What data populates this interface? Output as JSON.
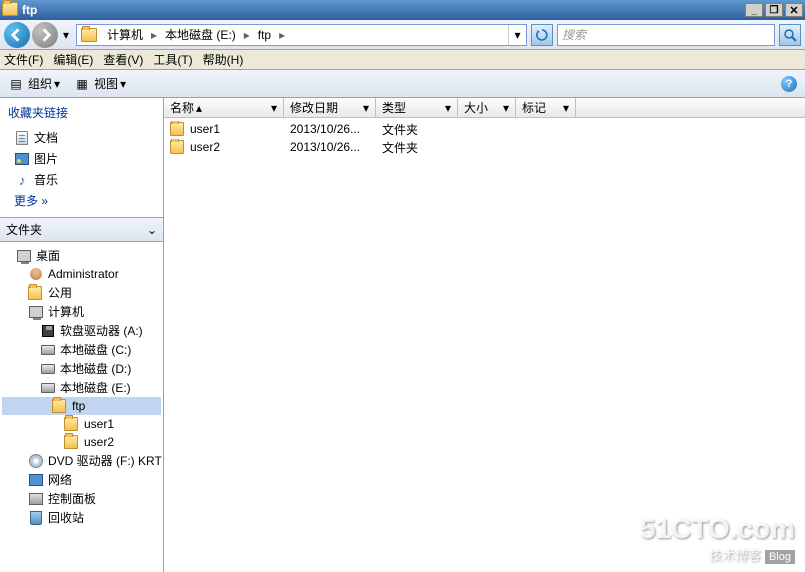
{
  "window": {
    "title": "ftp"
  },
  "nav": {
    "address_segments": [
      "计算机",
      "本地磁盘 (E:)",
      "ftp"
    ],
    "search_placeholder": "搜索"
  },
  "menu": {
    "file": "文件(F)",
    "edit": "编辑(E)",
    "view": "查看(V)",
    "tools": "工具(T)",
    "help": "帮助(H)"
  },
  "toolbar": {
    "organize": "组织",
    "views": "视图"
  },
  "favorites": {
    "header": "收藏夹链接",
    "items": [
      {
        "icon": "doc",
        "label": "文档"
      },
      {
        "icon": "pic",
        "label": "图片"
      },
      {
        "icon": "music",
        "label": "音乐"
      }
    ],
    "more": "更多  »"
  },
  "folders_header": "文件夹",
  "tree": [
    {
      "ind": 0,
      "icon": "desktop",
      "label": "桌面",
      "exp": ""
    },
    {
      "ind": 1,
      "icon": "user",
      "label": "Administrator",
      "exp": ""
    },
    {
      "ind": 1,
      "icon": "folder",
      "label": "公用",
      "exp": ""
    },
    {
      "ind": 1,
      "icon": "computer",
      "label": "计算机",
      "exp": ""
    },
    {
      "ind": 2,
      "icon": "floppy",
      "label": "软盘驱动器 (A:)",
      "exp": ""
    },
    {
      "ind": 2,
      "icon": "drive",
      "label": "本地磁盘 (C:)",
      "exp": ""
    },
    {
      "ind": 2,
      "icon": "drive",
      "label": "本地磁盘 (D:)",
      "exp": ""
    },
    {
      "ind": 2,
      "icon": "drive",
      "label": "本地磁盘 (E:)",
      "exp": ""
    },
    {
      "ind": 3,
      "icon": "folder",
      "label": "ftp",
      "exp": "",
      "sel": true
    },
    {
      "ind": 4,
      "icon": "folder",
      "label": "user1",
      "exp": ""
    },
    {
      "ind": 4,
      "icon": "folder",
      "label": "user2",
      "exp": ""
    },
    {
      "ind": 2,
      "icon": "cd",
      "label": "DVD 驱动器 (F:) KRT",
      "exp": ""
    },
    {
      "ind": 1,
      "icon": "net",
      "label": "网络",
      "exp": ""
    },
    {
      "ind": 1,
      "icon": "cp",
      "label": "控制面板",
      "exp": ""
    },
    {
      "ind": 1,
      "icon": "recycle",
      "label": "回收站",
      "exp": ""
    }
  ],
  "columns": {
    "name": "名称",
    "date": "修改日期",
    "type": "类型",
    "size": "大小",
    "tag": "标记"
  },
  "rows": [
    {
      "name": "user1",
      "date": "2013/10/26...",
      "type": "文件夹"
    },
    {
      "name": "user2",
      "date": "2013/10/26...",
      "type": "文件夹"
    }
  ],
  "watermark": {
    "big": "51CTO.com",
    "small": "技术博客",
    "tag": "Blog"
  }
}
